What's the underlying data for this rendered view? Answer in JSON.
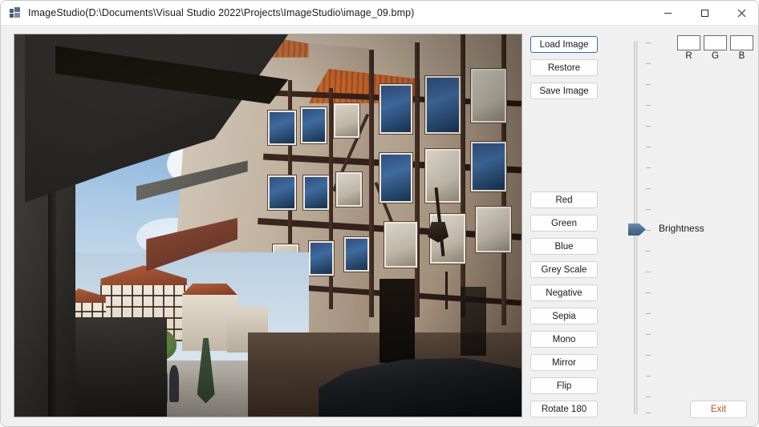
{
  "window": {
    "title": "ImageStudio(D:\\Documents\\Visual Studio 2022\\Projects\\ImageStudio\\image_09.bmp)",
    "app_icon": "app-window-icon",
    "controls": {
      "minimize": "minimize-icon",
      "maximize": "maximize-icon",
      "close": "close-icon"
    },
    "background_color": "#f0f0f0",
    "titlebar_color": "#ffffff"
  },
  "file_buttons": [
    {
      "label": "Load Image",
      "focused": true
    },
    {
      "label": "Restore",
      "focused": false
    },
    {
      "label": "Save Image",
      "focused": false
    }
  ],
  "filter_buttons": [
    {
      "label": "Red"
    },
    {
      "label": "Green"
    },
    {
      "label": "Blue"
    },
    {
      "label": "Grey Scale"
    },
    {
      "label": "Negative"
    },
    {
      "label": "Sepia"
    },
    {
      "label": "Mono"
    },
    {
      "label": "Mirror"
    },
    {
      "label": "Flip"
    },
    {
      "label": "Rotate 180"
    }
  ],
  "rgb_readout": [
    {
      "label": "R",
      "value": ""
    },
    {
      "label": "G",
      "value": ""
    },
    {
      "label": "B",
      "value": ""
    }
  ],
  "trackbar": {
    "label": "Brightness",
    "orientation": "vertical",
    "thumb_position_percent": 50,
    "tick_count": 19,
    "thumb_color": "#4a6f94"
  },
  "exit_button": {
    "label": "Exit",
    "text_color": "#b4541a"
  },
  "picture_box": {
    "image_name": "image_09.bmp",
    "description": "Photograph looking up a narrow cobbled street lined with German half-timbered (Fachwerk) houses; blue sky with white clouds, orange clay tile roof, pedestrians walking in the distance, a dark car parked at the lower right."
  }
}
